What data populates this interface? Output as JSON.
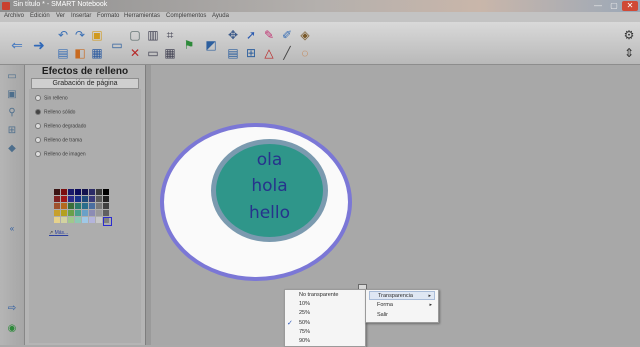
{
  "window": {
    "title": "Sin título * - SMART Notebook",
    "controls": [
      "—",
      "▢",
      "✕"
    ]
  },
  "menu": {
    "items": [
      "Archivo",
      "Edición",
      "Ver",
      "Insertar",
      "Formato",
      "Herramientas",
      "Complementos",
      "Ayuda"
    ]
  },
  "toolbar": {
    "icons": [
      "back-icon",
      "forward-icon",
      "undo-icon",
      "redo-icon",
      "add-page-icon",
      "delete-icon",
      "screen-shade-icon",
      "clear-icon",
      "document-camera-icon",
      "table-icon",
      "screen-capture-icon",
      "select-icon",
      "pen-icon",
      "creative-pen-icon",
      "eraser-icon",
      "line-icon",
      "shape-icon",
      "fill-icon",
      "text-icon",
      "properties-icon"
    ]
  },
  "panel": {
    "title": "Efectos de relleno",
    "subtitle": "Grabación de página",
    "options": [
      {
        "label": "Sin relleno",
        "checked": false
      },
      {
        "label": "Relleno sólido",
        "checked": true
      },
      {
        "label": "Relleno degradado",
        "checked": false
      },
      {
        "label": "Relleno de trama",
        "checked": false
      },
      {
        "label": "Relleno de imagen",
        "checked": false
      }
    ],
    "link": "Más...",
    "palette": [
      "#3a1414",
      "#7b0f0f",
      "#1a1a6a",
      "#0b0b5c",
      "#14144e",
      "#2c2c66",
      "#3a3a3a",
      "#000000",
      "#7f2222",
      "#a01818",
      "#2b2b8c",
      "#18308a",
      "#1f4a7a",
      "#3a3a7a",
      "#5a5a5a",
      "#202020",
      "#a0522d",
      "#b46a1e",
      "#3a6e3a",
      "#2c7a6a",
      "#2c6e8c",
      "#4a6ea0",
      "#7a7a7a",
      "#404040",
      "#c8a02c",
      "#b4a01e",
      "#6aa04a",
      "#4aa08c",
      "#6aa0c8",
      "#8c8cb4",
      "#9a9a9a",
      "#606060",
      "#e6d28c",
      "#d2d2a0",
      "#a0c88c",
      "#8cc8b4",
      "#a0c8e6",
      "#b4b4dc",
      "#c8c8c8",
      "#808080"
    ]
  },
  "canvas": {
    "words": [
      "ola",
      "hola",
      "hello"
    ],
    "colors": {
      "outer_fill": "#fafafa",
      "outer_border": "#7b77d6",
      "inner_fill": "#2f968a",
      "inner_border": "#7b9aaf",
      "text": "#26338c"
    }
  },
  "context_menu": {
    "items": [
      {
        "label": "No transparente",
        "checked": false
      },
      {
        "label": "10%",
        "checked": false
      },
      {
        "label": "25%",
        "checked": false
      },
      {
        "label": "50%",
        "checked": true
      },
      {
        "label": "75%",
        "checked": false
      },
      {
        "label": "90%",
        "checked": false
      }
    ],
    "check_glyph": "✓"
  },
  "submenu": {
    "items": [
      {
        "label": "Transparencia",
        "arrow": "▸"
      },
      {
        "label": "Forma",
        "arrow": "▸"
      },
      {
        "label": "Salir",
        "arrow": ""
      }
    ]
  }
}
